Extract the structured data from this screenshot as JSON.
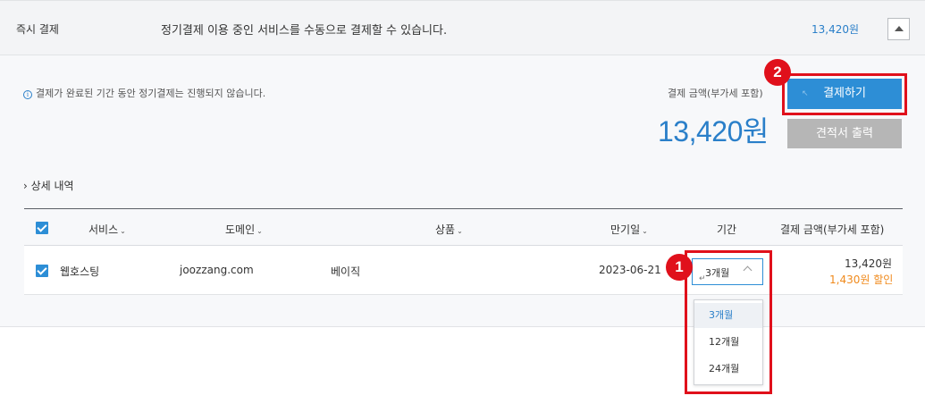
{
  "header": {
    "title": "즉시 결제",
    "description": "정기결제 이용 중인 서비스를 수동으로 결제할 수 있습니다.",
    "amount": "13,420원",
    "collapse_icon": "triangle-up-icon"
  },
  "notice": {
    "icon": "info-icon",
    "icon_glyph": "i",
    "text": "결제가 완료된 기간 동안 정기결제는 진행되지 않습니다."
  },
  "payment": {
    "label": "결제 금액(부가세 포함)",
    "amount": "13,420원",
    "pay_button": "결제하기",
    "estimate_button": "견적서 출력"
  },
  "detail_toggle": "› 상세 내역",
  "table": {
    "columns": [
      "서비스",
      "도메인",
      "상품",
      "만기일",
      "기간",
      "결제 금액(부가세 포함)"
    ],
    "sortable_caret": "⌄",
    "row": {
      "service": "웹호스팅",
      "domain": "joozzang.com",
      "product": "베이직",
      "expiry": "2023-06-21",
      "period": "3개월",
      "price": "13,420원",
      "discount": "1,430원 할인"
    }
  },
  "period_options": [
    "3개월",
    "12개월",
    "24개월"
  ],
  "annotations": {
    "badge_1": "1",
    "badge_2": "2",
    "highlight_color": "#e0101b"
  },
  "colors": {
    "accent": "#2d8ed6",
    "amount_blue": "#2a7fc9",
    "discount_orange": "#f08a1c",
    "estimate_gray": "#b6b6b6"
  }
}
